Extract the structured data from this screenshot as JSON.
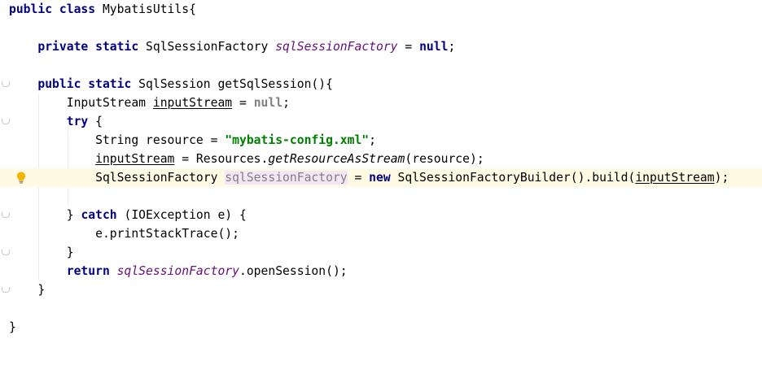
{
  "code": {
    "l1_public": "public",
    "l1_class": "class",
    "l1_name": " MybatisUtils{",
    "l3_private": "private",
    "l3_static": "static",
    "l3_type": " SqlSessionFactory ",
    "l3_field": "sqlSessionFactory",
    "l3_eq": " = ",
    "l3_null": "null",
    "l3_semi": ";",
    "l5_public": "public",
    "l5_static": "static",
    "l5_rest": " SqlSession getSqlSession(){",
    "l6_type": "InputStream ",
    "l6_var": "inputStream",
    "l6_eq": " = ",
    "l6_null": "null",
    "l6_semi": ";",
    "l7_try": "try",
    "l7_brace": " {",
    "l8_decl": "String resource = ",
    "l8_str": "\"mybatis-config.xml\"",
    "l8_semi": ";",
    "l9_var": "inputStream",
    "l9_mid": " = Resources.",
    "l9_method": "getResourceAsStream",
    "l9_rest": "(resource);",
    "l10_type": "SqlSessionFactory ",
    "l10_var": "sqlSessionFactory",
    "l10_eq": " = ",
    "l10_new": "new",
    "l10_mid": " SqlSessionFactoryBuilder().build(",
    "l10_arg": "inputStream",
    "l10_end": ");",
    "l12_brace": "} ",
    "l12_catch": "catch",
    "l12_rest": " (IOException e) {",
    "l13_stmt": "e.printStackTrace();",
    "l14_brace": "}",
    "l15_return": "return",
    "l15_field": "sqlSessionFactory",
    "l15_rest": ".openSession();",
    "l16_brace": "}",
    "l18_brace": "}"
  },
  "icons": {
    "intention": "lightbulb-icon",
    "fold": "fold-marker-icon"
  },
  "colors": {
    "keyword": "#000080",
    "string": "#008000",
    "field": "#660e7a",
    "current_line": "#fffae3",
    "unused": "#808080"
  }
}
